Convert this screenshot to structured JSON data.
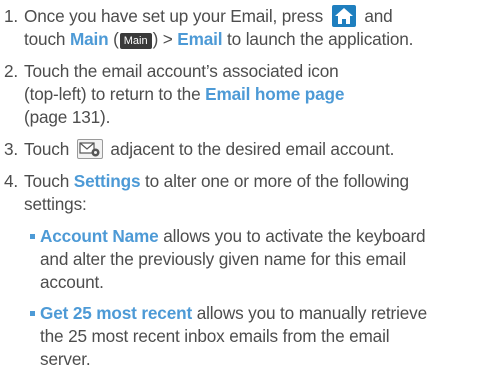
{
  "steps": [
    {
      "number": "1.",
      "line1_pre": "Once you have set up your Email, press",
      "line1_post": "and",
      "line2_pre": "touch",
      "main_label": "Main",
      "open_paren": "(",
      "main_tab_label": "Main",
      "close_paren_arrow": ") >",
      "email_label": "Email",
      "line2_post": "to launch the application."
    },
    {
      "number": "2.",
      "line1": "Touch the email account’s associated icon",
      "line2": "(top-left) to return to the",
      "email_home": "Email home page",
      "line3": "(page 131)."
    },
    {
      "number": "3.",
      "pre": "Touch",
      "post": "adjacent to the desired email account."
    },
    {
      "number": "4.",
      "pre": "Touch",
      "settings_label": "Settings",
      "post": "to alter one or more of the following",
      "line2": "settings:"
    }
  ],
  "bullets": [
    {
      "term": "Account Name",
      "line1_rest": "allows you to activate the keyboard",
      "line2": "and alter the previously given name for this email",
      "line3": "account."
    },
    {
      "term": "Get 25 most recent",
      "line1_rest": "allows you to manually retrieve",
      "line2": "the 25 most recent inbox emails from the email",
      "line3": "server."
    }
  ],
  "icons": {
    "home": "home-icon",
    "main_tab": "main-tab-icon",
    "email_settings": "email-settings-icon"
  },
  "colors": {
    "text": "#4d4d4d",
    "accent": "#4d9ad6",
    "home_icon_bg": "#1f7fbf"
  }
}
